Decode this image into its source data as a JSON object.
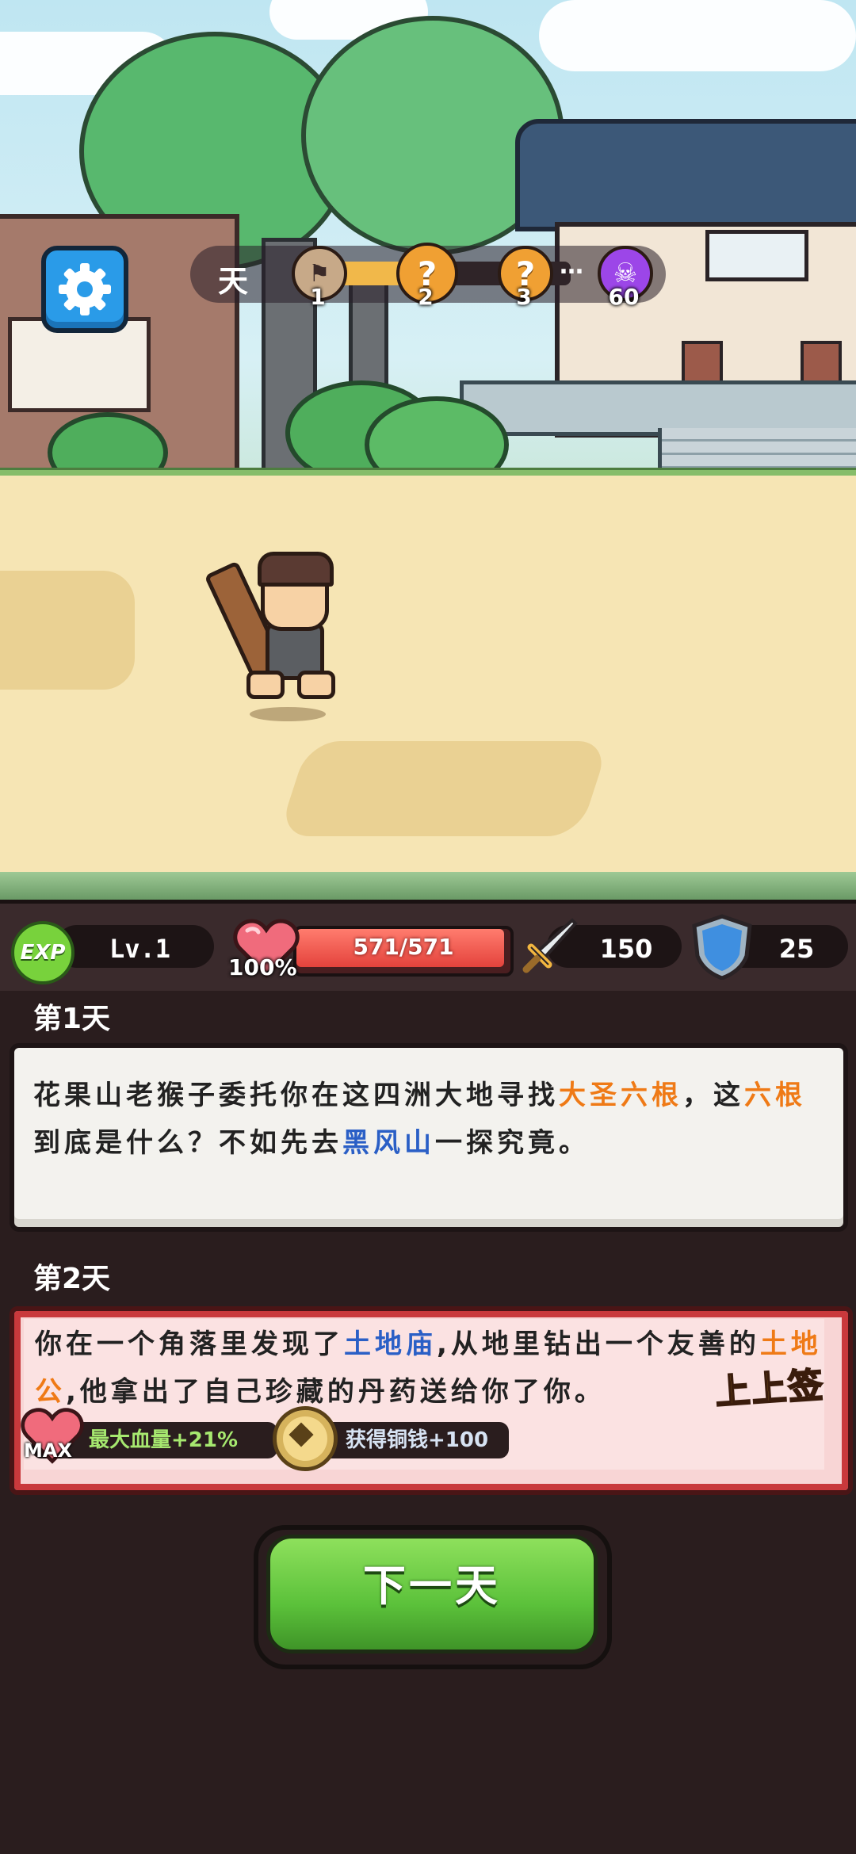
{
  "hud": {
    "day_label": "天",
    "progress_fraction": 0.35,
    "stage_nodes": [
      {
        "type": "flag",
        "label": "1"
      },
      {
        "type": "question",
        "label": "2",
        "symbol": "?"
      },
      {
        "type": "question",
        "label": "3",
        "symbol": "?"
      },
      {
        "type": "boss",
        "label": "60"
      }
    ],
    "ellipsis": "…",
    "settings_icon": "gear-icon"
  },
  "stats": {
    "exp_badge": "EXP",
    "level": "Lv.1",
    "hp_text": "571/571",
    "hp_fraction": 1.0,
    "hp_percent": "100%",
    "attack": "150",
    "defense": "25"
  },
  "log": {
    "day1": {
      "title": "第1天",
      "text_a": "花果山老猴子委托你在这四洲大地寻找",
      "hl_a": "大圣六根",
      "text_b": "，这",
      "hl_b": "六根",
      "text_c": "到底是什么？不如先去",
      "hl_c": "黑风山",
      "text_d": "一探究竟。"
    },
    "day2": {
      "title": "第2天",
      "text_a": "你在一个角落里发现了",
      "hl_a": "土地庙",
      "text_b": ",从地里钻出一个友善的",
      "hl_b": "土地公",
      "text_c": ",他拿出了自己珍藏的丹药送给你了你。",
      "luck": "上上签",
      "reward1": "最大血量+21%",
      "reward1_badge": "MAX",
      "reward2": "获得铜钱+100"
    }
  },
  "next_button": "下一天",
  "colors": {
    "orange_highlight": "#ef7a16",
    "blue_highlight": "#2a5fc6",
    "button_green": "#5bc13a",
    "hp_red": "#e4433c"
  }
}
